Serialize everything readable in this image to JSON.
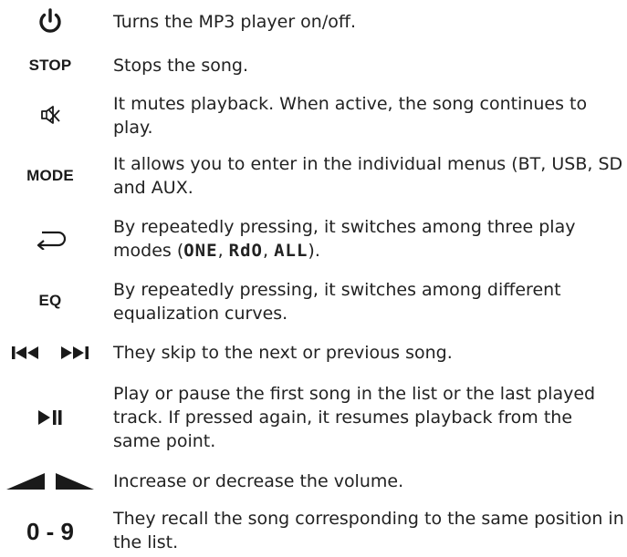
{
  "rows": [
    {
      "symbol": "power-icon",
      "text": "Turns the MP3 player on/off."
    },
    {
      "symbol_label": "STOP",
      "text": "Stops the song."
    },
    {
      "symbol": "mute-icon",
      "text": "It mutes playback. When active, the song continues to play."
    },
    {
      "symbol_label": "MODE",
      "text": "It allows you to enter in the individual menus (BT, USB, SD and AUX."
    },
    {
      "symbol": "repeat-icon",
      "text_before": "By repeatedly pressing, it switches among three play modes (",
      "modes": [
        "ONE",
        "RdO",
        "ALL"
      ],
      "mode_sep": ", ",
      "text_after": ")."
    },
    {
      "symbol_label": "EQ",
      "text": "By repeatedly pressing, it switches among different equalization curves."
    },
    {
      "symbol": "skip-prev-next-icons",
      "text": "They skip to the next or previous song."
    },
    {
      "symbol": "play-pause-icon",
      "text": "Play or pause the first song in the list or the last played track. If pressed again, it resumes playback from the same point."
    },
    {
      "symbol": "volume-icons",
      "text": "Increase or decrease the volume."
    },
    {
      "symbol_label": "0 - 9",
      "text": "They recall the song corresponding to the same position in the list."
    }
  ]
}
